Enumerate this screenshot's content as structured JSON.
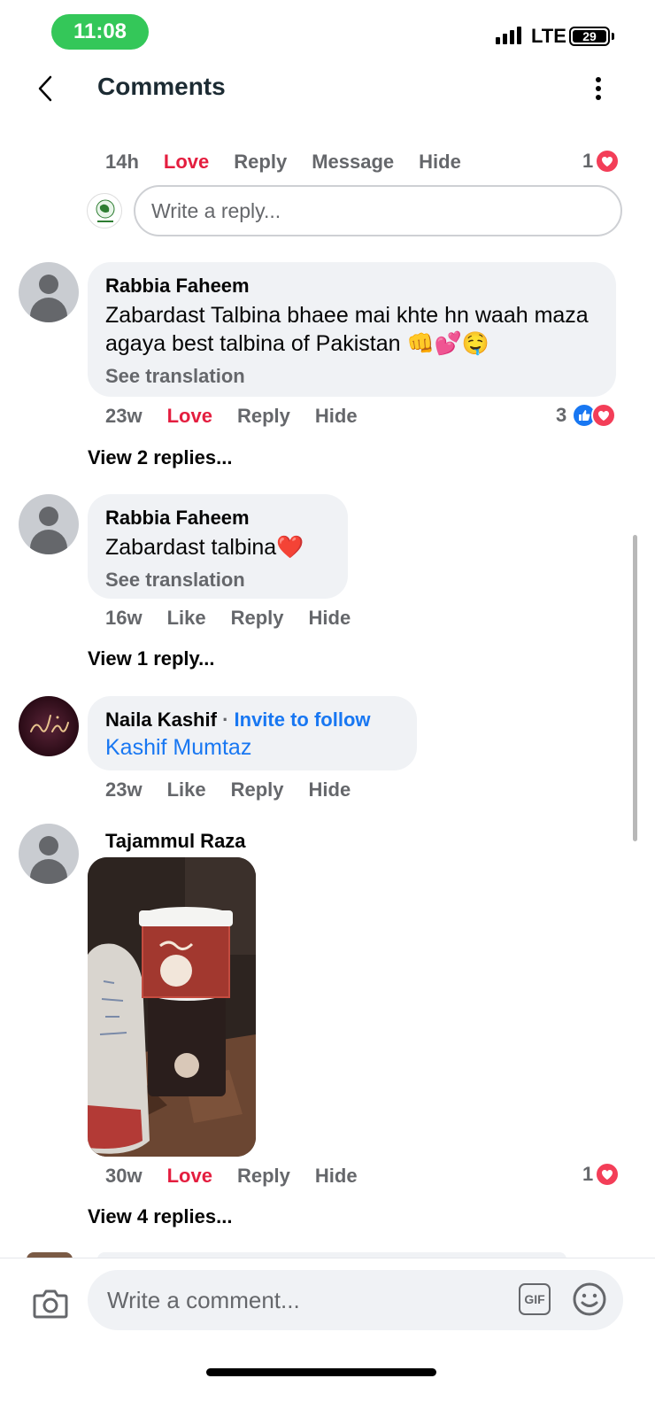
{
  "status_bar": {
    "time": "11:08",
    "network": "LTE",
    "battery": "29"
  },
  "header": {
    "title": "Comments"
  },
  "top_thread": {
    "time": "14h",
    "actions": {
      "love": "Love",
      "reply": "Reply",
      "message": "Message",
      "hide": "Hide"
    },
    "reaction_count": "1",
    "reply_placeholder": "Write a reply..."
  },
  "comments": [
    {
      "author": "Rabbia Faheem",
      "text": "Zabardast Talbina bhaee mai khte hn waah maza agaya best talbina of Pakistan 👊💕🤤",
      "see_translation": "See translation",
      "time": "23w",
      "actions": {
        "react": "Love",
        "reply": "Reply",
        "hide": "Hide"
      },
      "reaction_count": "3",
      "view_replies": "View 2 replies..."
    },
    {
      "author": "Rabbia Faheem",
      "text": "Zabardast talbina❤️",
      "see_translation": "See translation",
      "time": "16w",
      "actions": {
        "react": "Like",
        "reply": "Reply",
        "hide": "Hide"
      },
      "view_replies": "View 1 reply..."
    },
    {
      "author": "Naila Kashif",
      "separator": "·",
      "invite": "Invite to follow",
      "mention": "Kashif Mumtaz",
      "time": "23w",
      "actions": {
        "react": "Like",
        "reply": "Reply",
        "hide": "Hide"
      }
    },
    {
      "author": "Tajammul Raza",
      "time": "30w",
      "actions": {
        "react": "Love",
        "reply": "Reply",
        "hide": "Hide"
      },
      "reaction_count": "1",
      "view_replies": "View 4 replies..."
    }
  ],
  "composer": {
    "placeholder": "Write a comment...",
    "gif_label": "GIF"
  },
  "colors": {
    "love": "#e41e3f",
    "link": "#1877f2",
    "muted": "#65676b",
    "bubble": "#f0f2f5",
    "time_pill": "#34c759"
  }
}
